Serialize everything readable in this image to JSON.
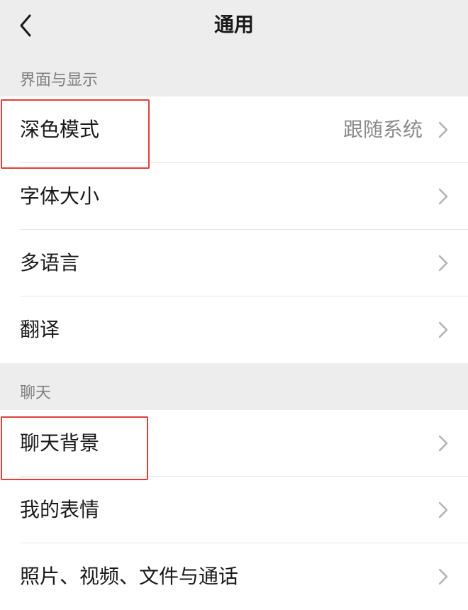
{
  "header": {
    "title": "通用",
    "back_icon": "chevron-left-icon"
  },
  "sections": [
    {
      "label": "界面与显示",
      "items": [
        {
          "label": "深色模式",
          "value": "跟随系统"
        },
        {
          "label": "字体大小"
        },
        {
          "label": "多语言"
        },
        {
          "label": "翻译"
        }
      ]
    },
    {
      "label": "聊天",
      "items": [
        {
          "label": "聊天背景"
        },
        {
          "label": "我的表情"
        },
        {
          "label": "照片、视频、文件与通话"
        }
      ]
    }
  ],
  "colors": {
    "page_bg": "#ededed",
    "row_bg": "#ffffff",
    "highlight_border": "#e0403a",
    "section_label": "#7f7f7f",
    "value_text": "#8a8a8a"
  }
}
